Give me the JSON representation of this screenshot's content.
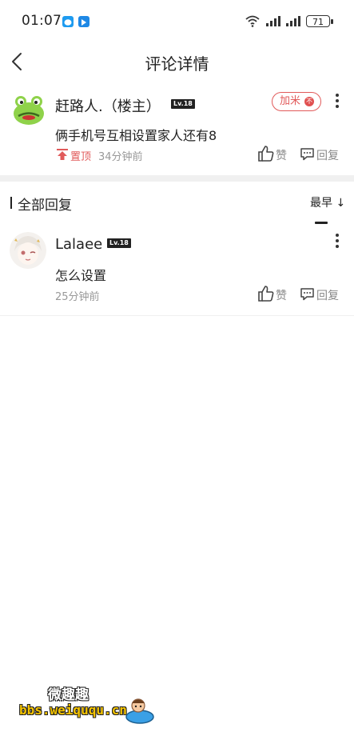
{
  "status_bar": {
    "time": "01:07",
    "battery": "71"
  },
  "header": {
    "title": "评论详情"
  },
  "comment": {
    "username": "赶路人.（楼主）",
    "level": "Lv.18",
    "follow_label": "加米",
    "follow_badge": "不",
    "text": "俩手机号互相设置家人还有8",
    "pin_label": "置顶",
    "time": "34分钟前",
    "like_label": "赞",
    "reply_label": "回复"
  },
  "replies_section": {
    "title": "全部回复",
    "sort_label": "最早 ↓"
  },
  "replies": [
    {
      "username": "Lalaee",
      "level": "Lv.18",
      "text": "怎么设置",
      "time": "25分钟前",
      "like_label": "赞",
      "reply_label": "回复"
    }
  ],
  "watermark": {
    "line1": "微趣趣",
    "line2": "bbs.weiququ.cn"
  },
  "colors": {
    "accent_red": "#e15a5a",
    "text": "#222222",
    "muted": "#999999",
    "divider": "#f0f0f0"
  }
}
